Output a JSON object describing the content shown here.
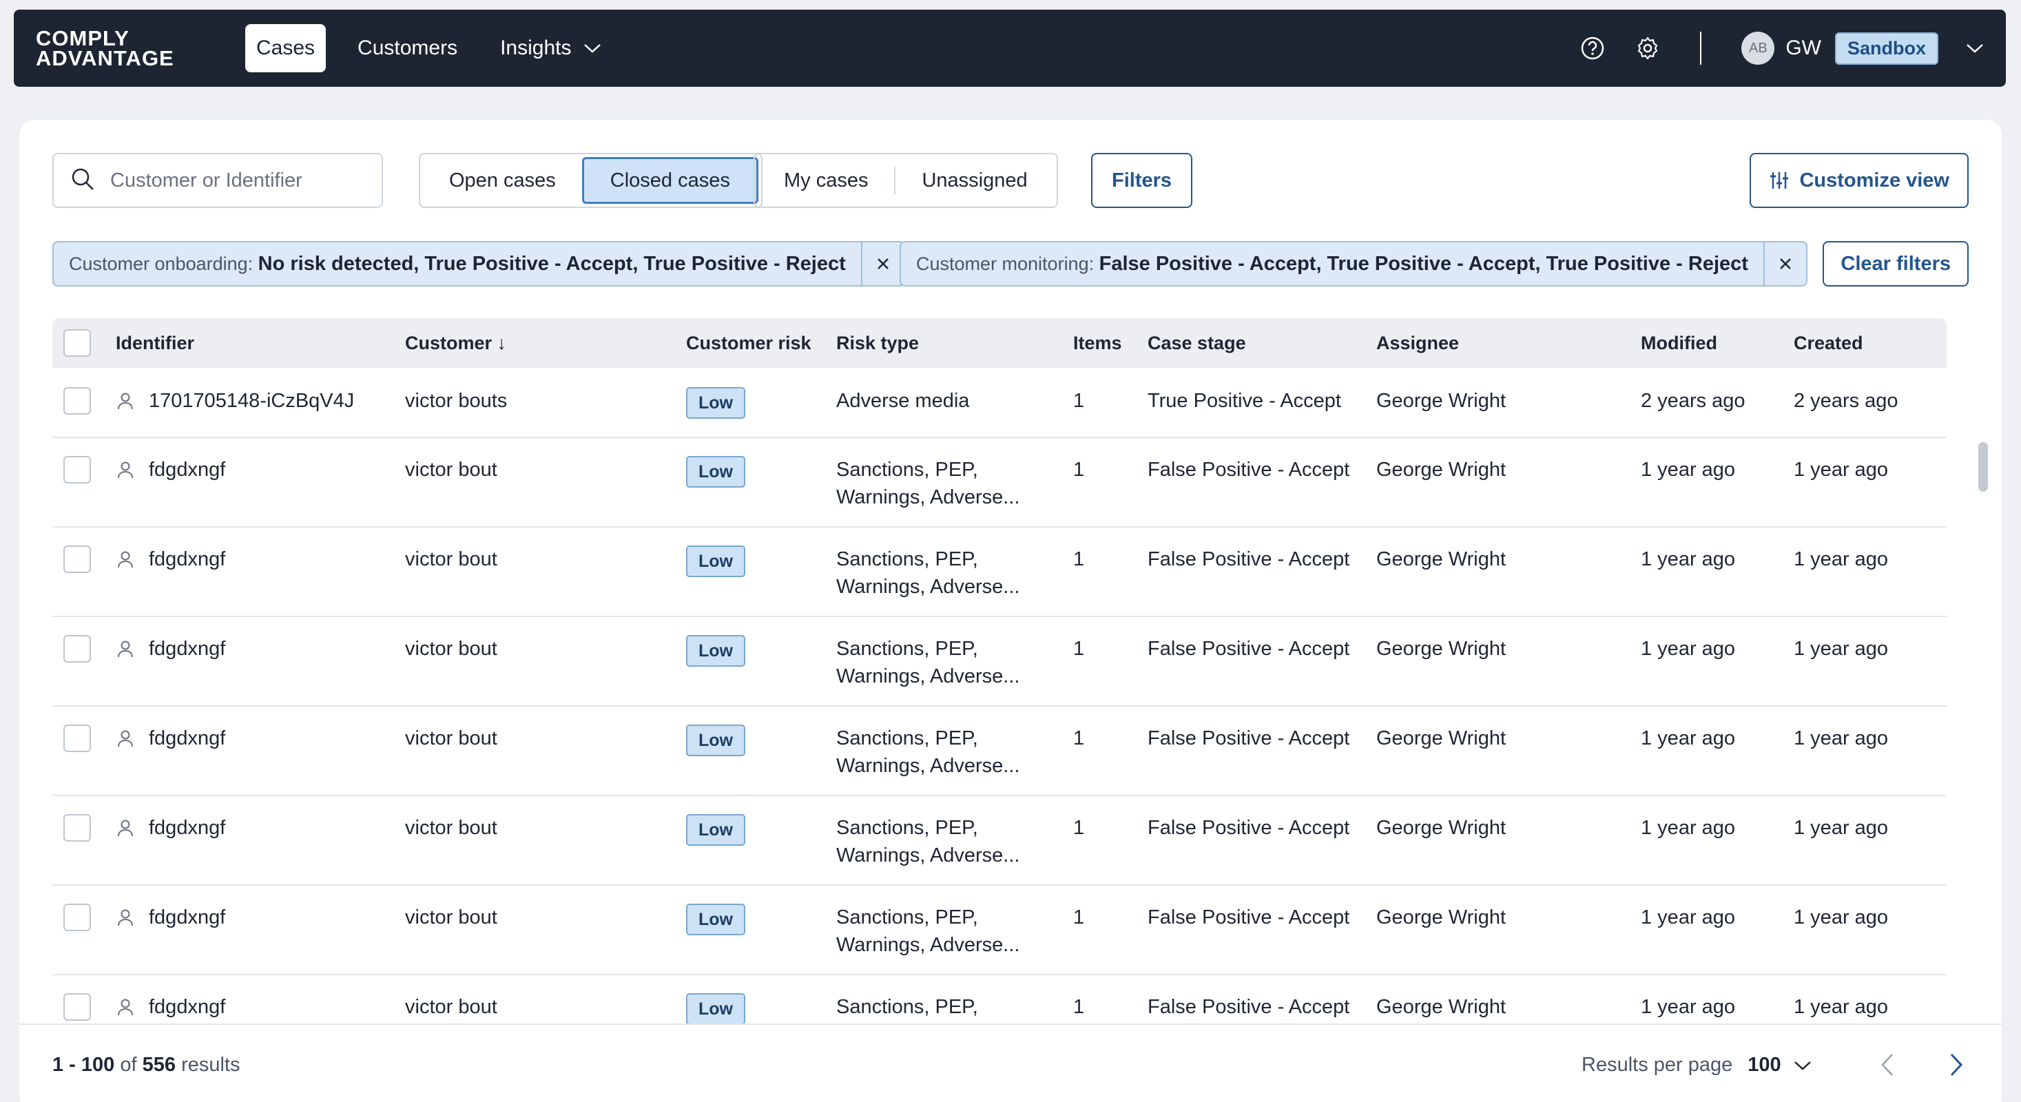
{
  "topnav": {
    "logo_line1": "COMPLY",
    "logo_line2": "ADVANTAGE",
    "items": [
      {
        "label": "Cases",
        "active": true
      },
      {
        "label": "Customers",
        "active": false
      },
      {
        "label": "Insights",
        "active": false,
        "has_dropdown": true
      }
    ],
    "icons": [
      "help-icon",
      "settings-icon"
    ],
    "avatar_initials": "AB",
    "user_initials": "GW",
    "environment_badge": "Sandbox"
  },
  "toolbar": {
    "search_placeholder": "Customer or Identifier",
    "case_status": {
      "open_label": "Open cases",
      "closed_label": "Closed cases",
      "selected": "closed"
    },
    "ownership": {
      "mine_label": "My cases",
      "unassigned_label": "Unassigned"
    },
    "filters_label": "Filters",
    "customize_label": "Customize view"
  },
  "active_filters": [
    {
      "key": "Customer onboarding:",
      "value": "No risk detected, True Positive - Accept, True Positive - Reject"
    },
    {
      "key": "Customer monitoring:",
      "value": "False Positive - Accept, True Positive - Accept, True Positive - Reject"
    }
  ],
  "clear_filters_label": "Clear filters",
  "table": {
    "columns": [
      "Identifier",
      "Customer ↓",
      "Customer risk",
      "Risk type",
      "Items",
      "Case stage",
      "Assignee",
      "Modified",
      "Created"
    ],
    "rows": [
      {
        "identifier": "1701705148-iCzBqV4J",
        "customer": "victor bouts",
        "risk": "Low",
        "risk_type_1": "Adverse media",
        "risk_type_2": "",
        "items": "1",
        "stage": "True Positive - Accept",
        "assignee": "George Wright",
        "modified": "2 years ago",
        "created": "2 years ago"
      },
      {
        "identifier": "fdgdxngf",
        "customer": "victor bout",
        "risk": "Low",
        "risk_type_1": "Sanctions, PEP,",
        "risk_type_2": "Warnings, Adverse...",
        "items": "1",
        "stage": "False Positive - Accept",
        "assignee": "George Wright",
        "modified": "1 year ago",
        "created": "1 year ago"
      },
      {
        "identifier": "fdgdxngf",
        "customer": "victor bout",
        "risk": "Low",
        "risk_type_1": "Sanctions, PEP,",
        "risk_type_2": "Warnings, Adverse...",
        "items": "1",
        "stage": "False Positive - Accept",
        "assignee": "George Wright",
        "modified": "1 year ago",
        "created": "1 year ago"
      },
      {
        "identifier": "fdgdxngf",
        "customer": "victor bout",
        "risk": "Low",
        "risk_type_1": "Sanctions, PEP,",
        "risk_type_2": "Warnings, Adverse...",
        "items": "1",
        "stage": "False Positive - Accept",
        "assignee": "George Wright",
        "modified": "1 year ago",
        "created": "1 year ago"
      },
      {
        "identifier": "fdgdxngf",
        "customer": "victor bout",
        "risk": "Low",
        "risk_type_1": "Sanctions, PEP,",
        "risk_type_2": "Warnings, Adverse...",
        "items": "1",
        "stage": "False Positive - Accept",
        "assignee": "George Wright",
        "modified": "1 year ago",
        "created": "1 year ago"
      },
      {
        "identifier": "fdgdxngf",
        "customer": "victor bout",
        "risk": "Low",
        "risk_type_1": "Sanctions, PEP,",
        "risk_type_2": "Warnings, Adverse...",
        "items": "1",
        "stage": "False Positive - Accept",
        "assignee": "George Wright",
        "modified": "1 year ago",
        "created": "1 year ago"
      },
      {
        "identifier": "fdgdxngf",
        "customer": "victor bout",
        "risk": "Low",
        "risk_type_1": "Sanctions, PEP,",
        "risk_type_2": "Warnings, Adverse...",
        "items": "1",
        "stage": "False Positive - Accept",
        "assignee": "George Wright",
        "modified": "1 year ago",
        "created": "1 year ago"
      },
      {
        "identifier": "fdgdxngf",
        "customer": "victor bout",
        "risk": "Low",
        "risk_type_1": "Sanctions, PEP,",
        "risk_type_2": "",
        "items": "1",
        "stage": "False Positive - Accept",
        "assignee": "George Wright",
        "modified": "1 year ago",
        "created": "1 year ago"
      }
    ]
  },
  "footer": {
    "range": "1 - 100",
    "of_label": "of",
    "total": "556",
    "results_label": "results",
    "per_page_label": "Results per page",
    "per_page_value": "100"
  }
}
